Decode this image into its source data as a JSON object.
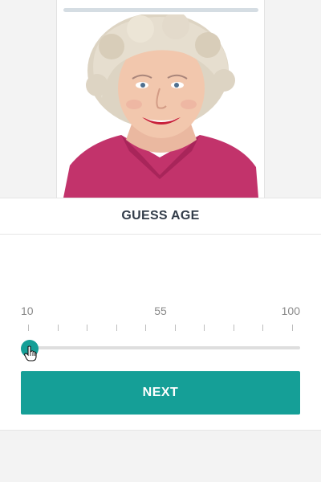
{
  "progress": {
    "fraction": 0
  },
  "photo": {
    "subject": "portrait of an elderly woman with white curly hair and a pink shirt"
  },
  "title": "GUESS AGE",
  "slider": {
    "min_label": "10",
    "mid_label": "55",
    "max_label": "100",
    "min": 10,
    "max": 100,
    "value": 10,
    "tick_count": 10
  },
  "next_button": {
    "label": "NEXT"
  },
  "colors": {
    "accent": "#159f97",
    "title": "#333d4a",
    "track": "#dedede",
    "background": "#f3f3f3"
  },
  "icons": {
    "cursor": "hand-pointer-icon"
  }
}
